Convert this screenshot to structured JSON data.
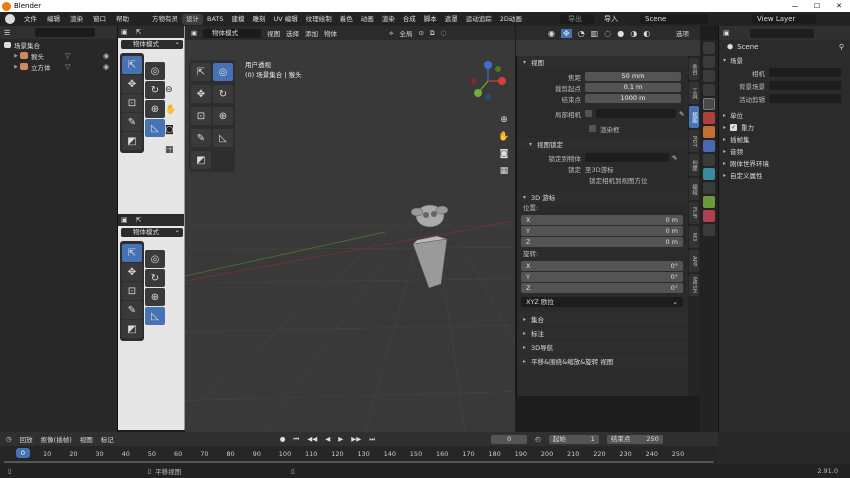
{
  "window": {
    "title": "Blender",
    "controls": [
      "—",
      "☐",
      "✕"
    ]
  },
  "menubar": {
    "menus": [
      "文件",
      "编辑",
      "渲染",
      "窗口",
      "帮助"
    ],
    "workspaces": [
      "方物有灵",
      "设计",
      "BATS",
      "建模",
      "雕刻",
      "UV 编辑",
      "纹理绘制",
      "着色",
      "动画",
      "渲染",
      "合成",
      "脚本",
      "遮罩",
      "运动追踪",
      "2D动画"
    ],
    "active_workspace": "设计",
    "search_placeholder": "导出",
    "import_label": "导入",
    "scene": "Scene",
    "view_layer": "View Layer"
  },
  "outliner": {
    "root": "场景集合",
    "items": [
      {
        "name": "猴头",
        "color": "#d08a5a"
      },
      {
        "name": "立方体",
        "color": "#d08a5a"
      }
    ]
  },
  "toolbar": {
    "mode_label": "物体模式",
    "tools": [
      "select-box",
      "cursor",
      "move",
      "rotate",
      "scale",
      "transform",
      "annotate",
      "measure",
      "add-cube"
    ]
  },
  "viewport": {
    "mode": "物体模式",
    "menus": [
      "视图",
      "选择",
      "添加",
      "物体"
    ],
    "transform_orientation": "全局",
    "info_line1": "用户透视",
    "info_line2": "(0) 场景集合 | 猴头",
    "options_label": "选项"
  },
  "npanel": {
    "view_header": "视图",
    "focal_label": "焦距",
    "focal_value": "50 mm",
    "clip_start_label": "裁剪起点",
    "clip_start_value": "0.1 m",
    "clip_end_label": "结束点",
    "clip_end_value": "1000 m",
    "local_camera_label": "局部相机",
    "render_region_label": "渲染框",
    "view_lock_header": "视图锁定",
    "lock_object_label": "锁定到物体",
    "lock_label": "锁定",
    "lock_cursor_label": "至3D游标",
    "lock_camera_label": "锁定相机到视图方位",
    "cursor_header": "3D 游标",
    "location_label": "位置:",
    "rotation_label": "旋转:",
    "x_label": "X",
    "y_label": "Y",
    "z_label": "Z",
    "loc_x": "0 m",
    "loc_y": "0 m",
    "loc_z": "0 m",
    "rot_x": "0°",
    "rot_y": "0°",
    "rot_z": "0°",
    "rotation_mode": "XYZ 欧拉",
    "collections_header": "集合",
    "annotations_header": "标注",
    "nav_header": "3D导航",
    "pan_header": "平移&围绕&缩放&旋转 视图",
    "tabs": [
      "条目",
      "工具",
      "视图",
      "PDT",
      "创建",
      "编辑",
      "FLIP",
      "M3",
      "APP",
      "MESH"
    ]
  },
  "properties": {
    "title": "Scene",
    "scene_header": "场景",
    "camera_label": "相机",
    "background_label": "背景场景",
    "active_clip_label": "活动剪辑",
    "sections": [
      "单位",
      "重力",
      "插帧集",
      "音频",
      "刚体世界环境",
      "自定义属性"
    ],
    "gravity_checked": true
  },
  "timeline": {
    "menus": [
      "回放",
      "抠像(插帧)",
      "视图",
      "标记"
    ],
    "current_frame": "0",
    "current_frame_marker": "0",
    "start_label": "起始",
    "start_value": "1",
    "end_label": "结束点",
    "end_value": "250",
    "ruler": [
      "10",
      "20",
      "30",
      "40",
      "50",
      "60",
      "70",
      "80",
      "90",
      "100",
      "110",
      "120",
      "130",
      "140",
      "150",
      "160",
      "170",
      "180",
      "190",
      "200",
      "210",
      "220",
      "230",
      "240",
      "250"
    ]
  },
  "status": {
    "pan_hint": "平移视图",
    "version": "2.91.0"
  },
  "colors": {
    "accent": "#4772b3",
    "axis_x": "#d04040",
    "axis_y": "#70b030",
    "axis_z": "#3a70d0"
  }
}
